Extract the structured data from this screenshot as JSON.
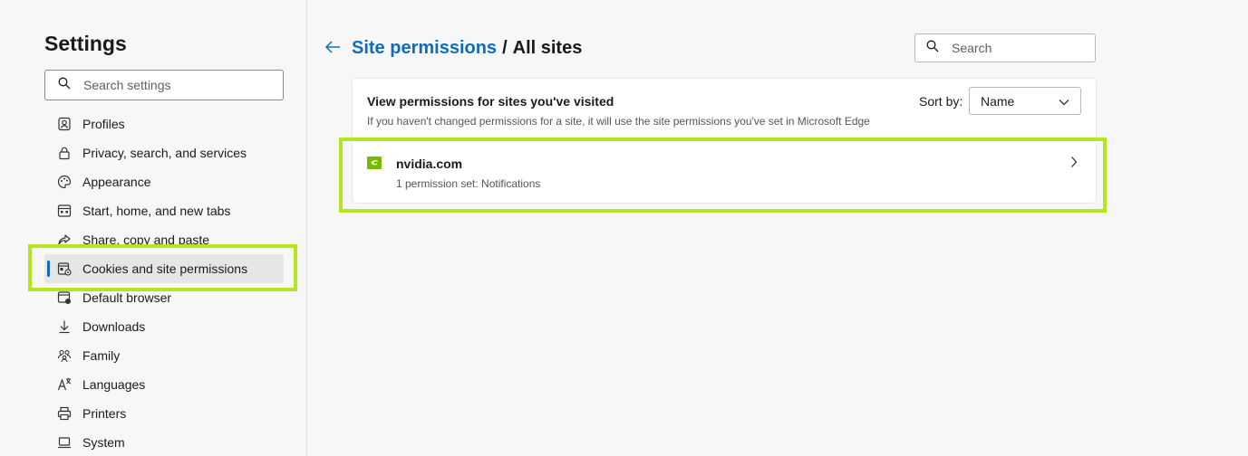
{
  "sidebar": {
    "title": "Settings",
    "search_placeholder": "Search settings",
    "items": [
      {
        "label": "Profiles",
        "icon": "profile-icon"
      },
      {
        "label": "Privacy, search, and services",
        "icon": "lock-icon"
      },
      {
        "label": "Appearance",
        "icon": "palette-icon"
      },
      {
        "label": "Start, home, and new tabs",
        "icon": "home-tabs-icon"
      },
      {
        "label": "Share, copy and paste",
        "icon": "share-icon"
      },
      {
        "label": "Cookies and site permissions",
        "icon": "cookies-icon"
      },
      {
        "label": "Default browser",
        "icon": "browser-icon"
      },
      {
        "label": "Downloads",
        "icon": "download-icon"
      },
      {
        "label": "Family",
        "icon": "family-icon"
      },
      {
        "label": "Languages",
        "icon": "languages-icon"
      },
      {
        "label": "Printers",
        "icon": "printer-icon"
      },
      {
        "label": "System",
        "icon": "laptop-icon"
      }
    ],
    "active_index": 5
  },
  "header": {
    "breadcrumb_link": "Site permissions",
    "separator": "/",
    "current": "All sites",
    "search_placeholder": "Search"
  },
  "card": {
    "title": "View permissions for sites you've visited",
    "description": "If you haven't changed permissions for a site, it will use the site permissions you've set in Microsoft Edge",
    "sort_label": "Sort by:",
    "sort_value": "Name"
  },
  "sites": [
    {
      "name": "nvidia.com",
      "permissions": "1 permission set: Notifications",
      "favicon_color": "#76b900"
    }
  ],
  "colors": {
    "accent": "#0f6cbd",
    "highlight": "#b5e61d"
  }
}
